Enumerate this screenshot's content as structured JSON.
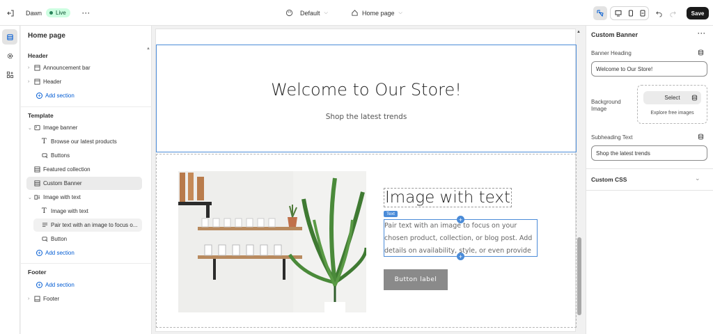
{
  "topbar": {
    "theme_name": "Dawn",
    "live_label": "Live",
    "more_label": "···",
    "preset_label": "Default",
    "page_label": "Home page",
    "save_label": "Save"
  },
  "sidebar": {
    "title": "Home page",
    "header_group": "Header",
    "header_items": [
      "Announcement bar",
      "Header"
    ],
    "add_section": "Add section",
    "template_group": "Template",
    "template_items": {
      "image_banner": "Image banner",
      "browse": "Browse our latest products",
      "buttons": "Buttons",
      "featured": "Featured collection",
      "custom_banner": "Custom Banner",
      "image_with_text": "Image with text",
      "iwt_heading": "Image with text",
      "iwt_text": "Pair text with an image to focus o...",
      "iwt_button": "Button"
    },
    "footer_group": "Footer",
    "footer_item": "Footer"
  },
  "canvas": {
    "banner_heading": "Welcome to Our Store!",
    "banner_subheading": "Shop the latest trends",
    "iwt_heading": "Image with text",
    "text_tag": "Text",
    "iwt_body": "Pair text with an image to focus on your chosen product, collection, or blog post. Add details on availability, style, or even provide a review.",
    "iwt_button": "Button label"
  },
  "panel": {
    "title": "Custom Banner",
    "more_label": "···",
    "heading_label": "Banner Heading",
    "heading_value": "Welcome to Our Store!",
    "bg_label": "Background Image",
    "select_label": "Select",
    "explore_label": "Explore free images",
    "sub_label": "Subheading Text",
    "sub_value": "Shop the latest trends",
    "css_label": "Custom CSS"
  },
  "colors": {
    "accent": "#005bd3",
    "selection": "#4a8bd8",
    "live_bg": "#cdfee1"
  }
}
